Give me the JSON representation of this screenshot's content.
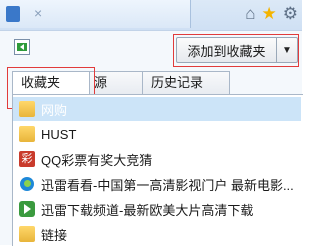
{
  "browser": {
    "tab_title": "×",
    "tab_faded_text": "",
    "toolbar_icons": [
      "home-icon",
      "star-icon",
      "gear-icon"
    ]
  },
  "favorites_panel": {
    "add_button_label": "添加到收藏夹",
    "tabs": [
      {
        "label": "收藏夹",
        "active": true
      },
      {
        "label": "源",
        "active": false
      },
      {
        "label": "历史记录",
        "active": false
      }
    ],
    "items": [
      {
        "label": "网购",
        "icon": "folder-icon",
        "selected": true
      },
      {
        "label": "HUST",
        "icon": "folder-icon",
        "selected": false
      },
      {
        "label": "QQ彩票有奖大竞猜",
        "icon": "qq-lottery-icon",
        "selected": false
      },
      {
        "label": "迅雷看看-中国第一高清影视门户 最新电影...",
        "icon": "xunlei-icon",
        "selected": false
      },
      {
        "label": "迅雷下载频道-最新欧美大片高清下载",
        "icon": "download-icon",
        "selected": false
      },
      {
        "label": "链接",
        "icon": "folder-icon",
        "selected": false
      }
    ]
  },
  "colors": {
    "highlight_box": "#e13b3b",
    "selection_bg": "#cce4f8"
  }
}
